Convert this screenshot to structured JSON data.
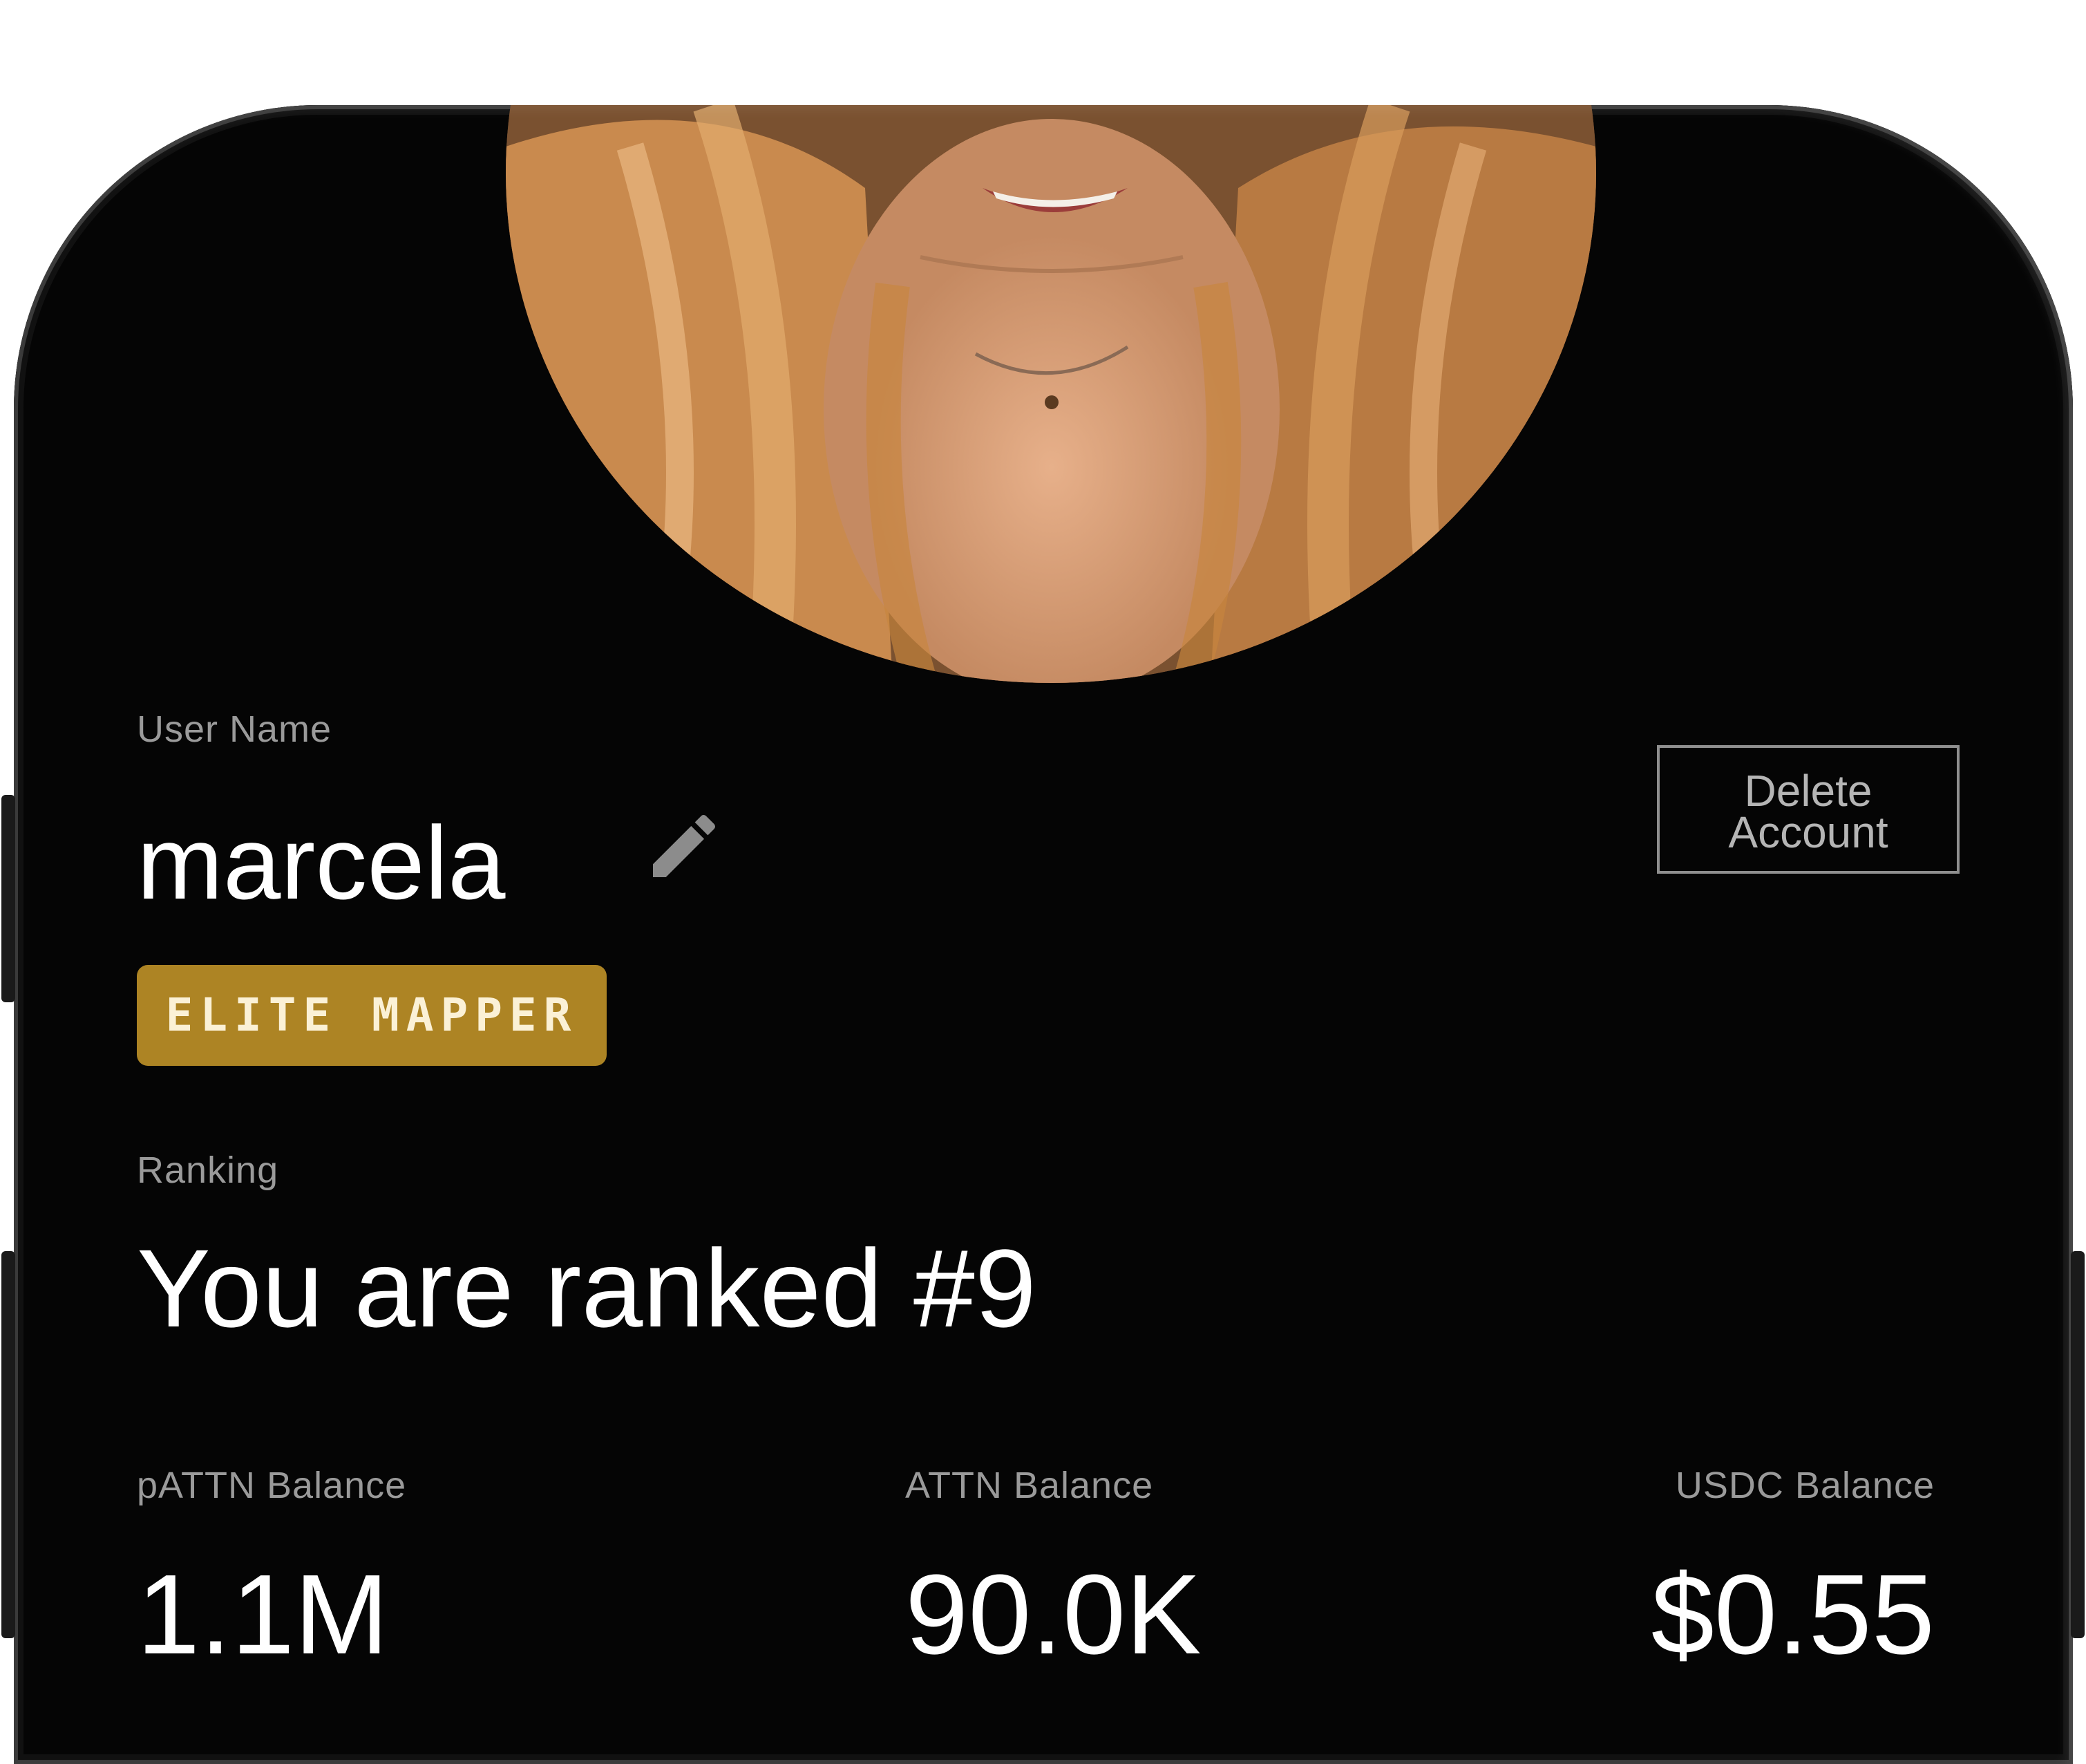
{
  "profile": {
    "username_label": "User Name",
    "username": "marcela",
    "delete_line1": "Delete",
    "delete_line2": "Account",
    "badge": "ELITE MAPPER",
    "ranking_label": "Ranking",
    "ranking_text": "You are ranked #9"
  },
  "balances": [
    {
      "label": "pATTN Balance",
      "value": "1.1M"
    },
    {
      "label": "ATTN Balance",
      "value": "90.0K"
    },
    {
      "label": "USDC Balance",
      "value": "$0.55"
    }
  ],
  "colors": {
    "background": "#050505",
    "badge": "#ad8424",
    "label": "#9a9a9a",
    "text": "#ffffff"
  },
  "icons": {
    "edit": "pencil-icon"
  }
}
